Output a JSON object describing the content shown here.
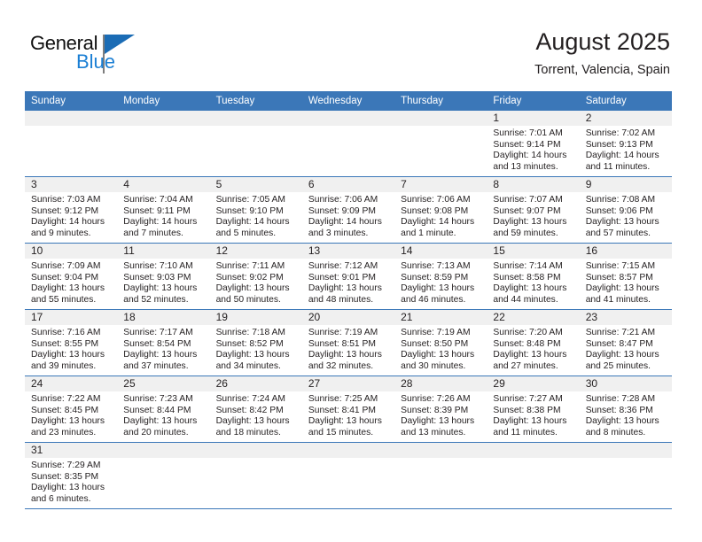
{
  "brand": {
    "name_part1": "General",
    "name_part2": "Blue",
    "accent_color": "#1b7fd4",
    "triangle_color": "#1b6cb5"
  },
  "header": {
    "title": "August 2025",
    "subtitle": "Torrent, Valencia, Spain"
  },
  "theme": {
    "header_blue": "#3b77b8",
    "day_band_gray": "#f0f0f0",
    "text": "#231f20"
  },
  "weekdays": [
    "Sunday",
    "Monday",
    "Tuesday",
    "Wednesday",
    "Thursday",
    "Friday",
    "Saturday"
  ],
  "weeks": [
    [
      {
        "day": "",
        "lines": []
      },
      {
        "day": "",
        "lines": []
      },
      {
        "day": "",
        "lines": []
      },
      {
        "day": "",
        "lines": []
      },
      {
        "day": "",
        "lines": []
      },
      {
        "day": "1",
        "lines": [
          "Sunrise: 7:01 AM",
          "Sunset: 9:14 PM",
          "Daylight: 14 hours",
          "and 13 minutes."
        ]
      },
      {
        "day": "2",
        "lines": [
          "Sunrise: 7:02 AM",
          "Sunset: 9:13 PM",
          "Daylight: 14 hours",
          "and 11 minutes."
        ]
      }
    ],
    [
      {
        "day": "3",
        "lines": [
          "Sunrise: 7:03 AM",
          "Sunset: 9:12 PM",
          "Daylight: 14 hours",
          "and 9 minutes."
        ]
      },
      {
        "day": "4",
        "lines": [
          "Sunrise: 7:04 AM",
          "Sunset: 9:11 PM",
          "Daylight: 14 hours",
          "and 7 minutes."
        ]
      },
      {
        "day": "5",
        "lines": [
          "Sunrise: 7:05 AM",
          "Sunset: 9:10 PM",
          "Daylight: 14 hours",
          "and 5 minutes."
        ]
      },
      {
        "day": "6",
        "lines": [
          "Sunrise: 7:06 AM",
          "Sunset: 9:09 PM",
          "Daylight: 14 hours",
          "and 3 minutes."
        ]
      },
      {
        "day": "7",
        "lines": [
          "Sunrise: 7:06 AM",
          "Sunset: 9:08 PM",
          "Daylight: 14 hours",
          "and 1 minute."
        ]
      },
      {
        "day": "8",
        "lines": [
          "Sunrise: 7:07 AM",
          "Sunset: 9:07 PM",
          "Daylight: 13 hours",
          "and 59 minutes."
        ]
      },
      {
        "day": "9",
        "lines": [
          "Sunrise: 7:08 AM",
          "Sunset: 9:06 PM",
          "Daylight: 13 hours",
          "and 57 minutes."
        ]
      }
    ],
    [
      {
        "day": "10",
        "lines": [
          "Sunrise: 7:09 AM",
          "Sunset: 9:04 PM",
          "Daylight: 13 hours",
          "and 55 minutes."
        ]
      },
      {
        "day": "11",
        "lines": [
          "Sunrise: 7:10 AM",
          "Sunset: 9:03 PM",
          "Daylight: 13 hours",
          "and 52 minutes."
        ]
      },
      {
        "day": "12",
        "lines": [
          "Sunrise: 7:11 AM",
          "Sunset: 9:02 PM",
          "Daylight: 13 hours",
          "and 50 minutes."
        ]
      },
      {
        "day": "13",
        "lines": [
          "Sunrise: 7:12 AM",
          "Sunset: 9:01 PM",
          "Daylight: 13 hours",
          "and 48 minutes."
        ]
      },
      {
        "day": "14",
        "lines": [
          "Sunrise: 7:13 AM",
          "Sunset: 8:59 PM",
          "Daylight: 13 hours",
          "and 46 minutes."
        ]
      },
      {
        "day": "15",
        "lines": [
          "Sunrise: 7:14 AM",
          "Sunset: 8:58 PM",
          "Daylight: 13 hours",
          "and 44 minutes."
        ]
      },
      {
        "day": "16",
        "lines": [
          "Sunrise: 7:15 AM",
          "Sunset: 8:57 PM",
          "Daylight: 13 hours",
          "and 41 minutes."
        ]
      }
    ],
    [
      {
        "day": "17",
        "lines": [
          "Sunrise: 7:16 AM",
          "Sunset: 8:55 PM",
          "Daylight: 13 hours",
          "and 39 minutes."
        ]
      },
      {
        "day": "18",
        "lines": [
          "Sunrise: 7:17 AM",
          "Sunset: 8:54 PM",
          "Daylight: 13 hours",
          "and 37 minutes."
        ]
      },
      {
        "day": "19",
        "lines": [
          "Sunrise: 7:18 AM",
          "Sunset: 8:52 PM",
          "Daylight: 13 hours",
          "and 34 minutes."
        ]
      },
      {
        "day": "20",
        "lines": [
          "Sunrise: 7:19 AM",
          "Sunset: 8:51 PM",
          "Daylight: 13 hours",
          "and 32 minutes."
        ]
      },
      {
        "day": "21",
        "lines": [
          "Sunrise: 7:19 AM",
          "Sunset: 8:50 PM",
          "Daylight: 13 hours",
          "and 30 minutes."
        ]
      },
      {
        "day": "22",
        "lines": [
          "Sunrise: 7:20 AM",
          "Sunset: 8:48 PM",
          "Daylight: 13 hours",
          "and 27 minutes."
        ]
      },
      {
        "day": "23",
        "lines": [
          "Sunrise: 7:21 AM",
          "Sunset: 8:47 PM",
          "Daylight: 13 hours",
          "and 25 minutes."
        ]
      }
    ],
    [
      {
        "day": "24",
        "lines": [
          "Sunrise: 7:22 AM",
          "Sunset: 8:45 PM",
          "Daylight: 13 hours",
          "and 23 minutes."
        ]
      },
      {
        "day": "25",
        "lines": [
          "Sunrise: 7:23 AM",
          "Sunset: 8:44 PM",
          "Daylight: 13 hours",
          "and 20 minutes."
        ]
      },
      {
        "day": "26",
        "lines": [
          "Sunrise: 7:24 AM",
          "Sunset: 8:42 PM",
          "Daylight: 13 hours",
          "and 18 minutes."
        ]
      },
      {
        "day": "27",
        "lines": [
          "Sunrise: 7:25 AM",
          "Sunset: 8:41 PM",
          "Daylight: 13 hours",
          "and 15 minutes."
        ]
      },
      {
        "day": "28",
        "lines": [
          "Sunrise: 7:26 AM",
          "Sunset: 8:39 PM",
          "Daylight: 13 hours",
          "and 13 minutes."
        ]
      },
      {
        "day": "29",
        "lines": [
          "Sunrise: 7:27 AM",
          "Sunset: 8:38 PM",
          "Daylight: 13 hours",
          "and 11 minutes."
        ]
      },
      {
        "day": "30",
        "lines": [
          "Sunrise: 7:28 AM",
          "Sunset: 8:36 PM",
          "Daylight: 13 hours",
          "and 8 minutes."
        ]
      }
    ],
    [
      {
        "day": "31",
        "lines": [
          "Sunrise: 7:29 AM",
          "Sunset: 8:35 PM",
          "Daylight: 13 hours",
          "and 6 minutes."
        ]
      },
      {
        "day": "",
        "lines": []
      },
      {
        "day": "",
        "lines": []
      },
      {
        "day": "",
        "lines": []
      },
      {
        "day": "",
        "lines": []
      },
      {
        "day": "",
        "lines": []
      },
      {
        "day": "",
        "lines": []
      }
    ]
  ]
}
